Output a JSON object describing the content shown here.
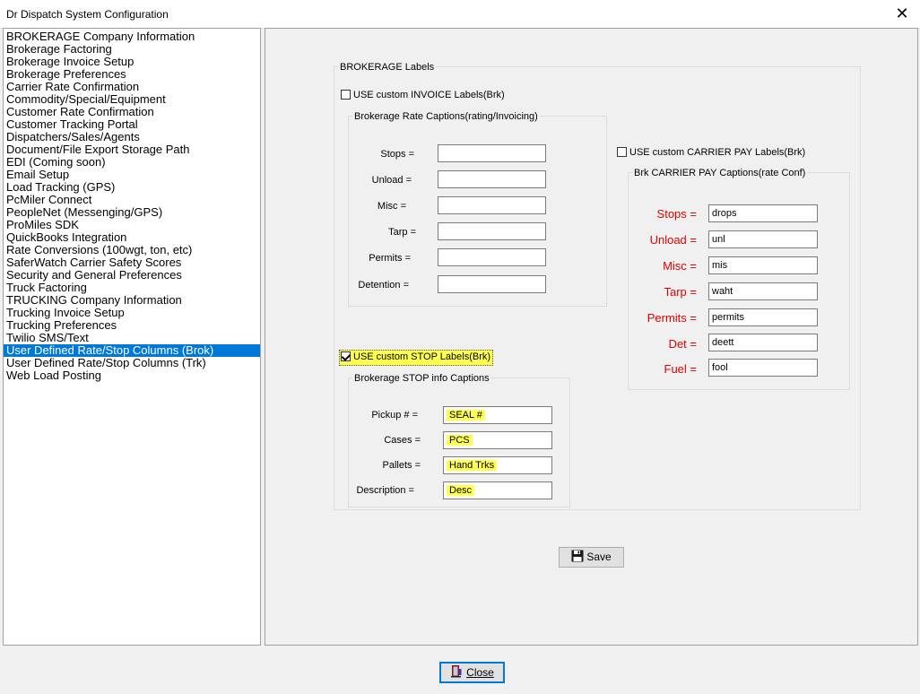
{
  "window": {
    "title": "Dr Dispatch  System Configuration",
    "close_glyph": "✕"
  },
  "sidebar": {
    "items": [
      "BROKERAGE Company Information",
      "Brokerage Factoring",
      "Brokerage Invoice Setup",
      "Brokerage Preferences",
      "Carrier Rate Confirmation",
      "Commodity/Special/Equipment",
      "Customer Rate Confirmation",
      "Customer Tracking Portal",
      "Dispatchers/Sales/Agents",
      "Document/File Export Storage Path",
      "EDI (Coming soon)",
      "Email Setup",
      "Load Tracking (GPS)",
      "PcMiler Connect",
      "PeopleNet (Messenging/GPS)",
      "ProMiles SDK",
      "QuickBooks Integration",
      "Rate Conversions (100wgt, ton, etc)",
      "SaferWatch Carrier Safety Scores",
      "Security and General Preferences",
      "Truck Factoring",
      "TRUCKING Company Information",
      "Trucking Invoice Setup",
      "Trucking Preferences",
      "Twilio SMS/Text",
      "User Defined Rate/Stop Columns (Brok)",
      "User Defined Rate/Stop Columns (Trk)",
      "Web Load Posting"
    ],
    "selected": "User Defined Rate/Stop Columns (Brok)"
  },
  "main": {
    "outer_group_title": "BROKERAGE Labels",
    "invoice_checkbox": {
      "label": "USE custom INVOICE Labels(Brk)",
      "checked": false
    },
    "rate_group": {
      "title": "Brokerage Rate Captions(rating/Invoicing)",
      "fields": [
        {
          "label": "Stops =",
          "value": ""
        },
        {
          "label": "Unload =",
          "value": ""
        },
        {
          "label": "Misc =",
          "value": ""
        },
        {
          "label": "Tarp =",
          "value": ""
        },
        {
          "label": "Permits =",
          "value": ""
        },
        {
          "label": "Detention =",
          "value": ""
        }
      ]
    },
    "carrier_checkbox": {
      "label": "USE custom CARRIER PAY Labels(Brk)",
      "checked": false
    },
    "carrier_group": {
      "title": "Brk CARRIER PAY Captions(rate Conf)",
      "fields": [
        {
          "label": "Stops =",
          "value": "drops"
        },
        {
          "label": "Unload =",
          "value": "unl"
        },
        {
          "label": "Misc =",
          "value": "mis"
        },
        {
          "label": "Tarp =",
          "value": "waht"
        },
        {
          "label": "Permits =",
          "value": "permits"
        },
        {
          "label": "Det =",
          "value": "deett"
        },
        {
          "label": "Fuel =",
          "value": "fool"
        }
      ]
    },
    "stop_checkbox": {
      "label": "USE custom STOP Labels(Brk)",
      "checked": true
    },
    "stop_group": {
      "title": "Brokerage STOP info Captions",
      "fields": [
        {
          "label": "Pickup # =",
          "value": "SEAL #"
        },
        {
          "label": "Cases =",
          "value": "PCS"
        },
        {
          "label": "Pallets =",
          "value": "Hand Trks"
        },
        {
          "label": "Description =",
          "value": "Desc"
        }
      ]
    },
    "save_label": "Save"
  },
  "footer": {
    "close_label": "Close"
  },
  "colors": {
    "selection": "#0078d7",
    "highlight": "#ffff4d",
    "red_label": "#e00000"
  }
}
